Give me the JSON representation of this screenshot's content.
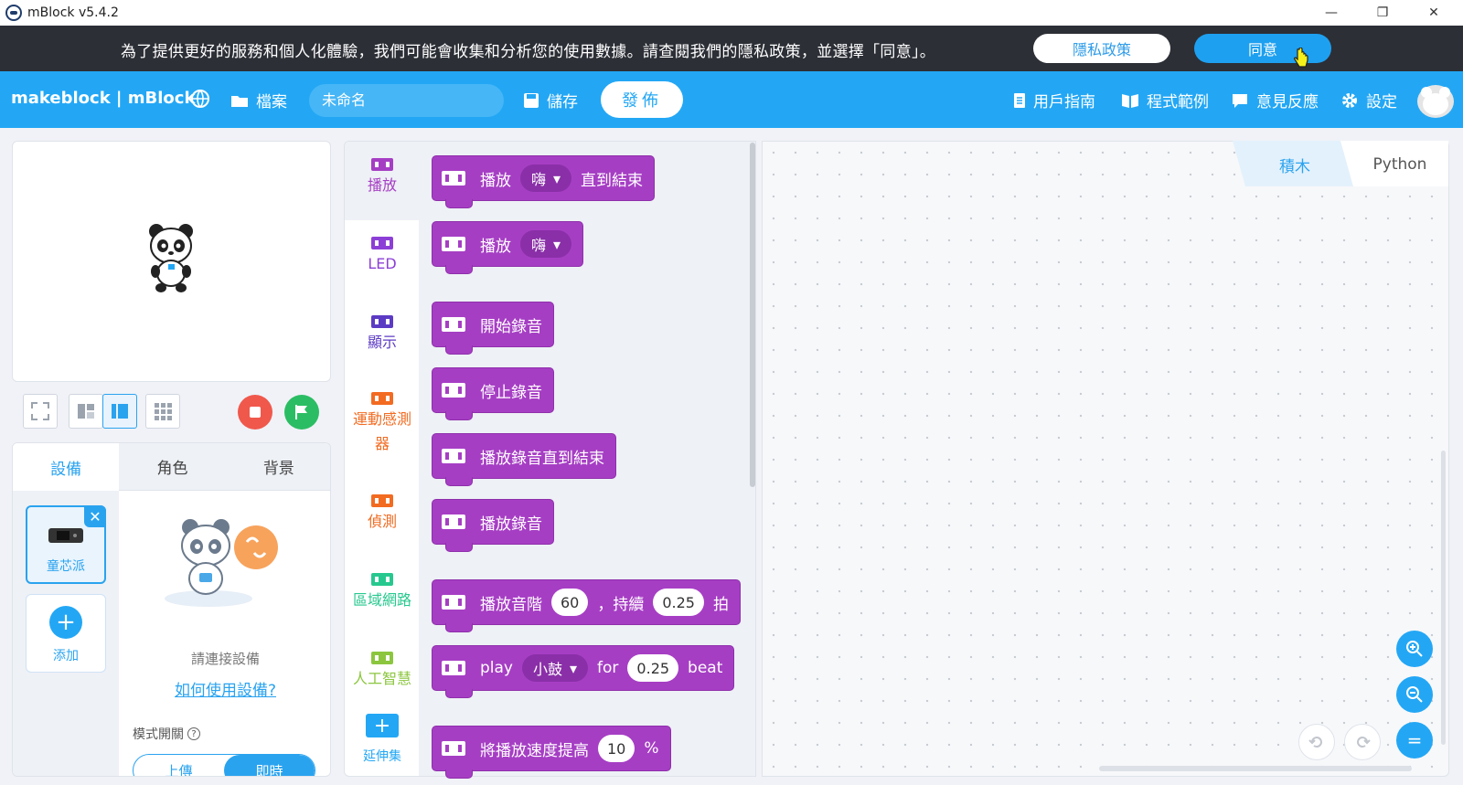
{
  "window": {
    "title": "mBlock v5.4.2",
    "controls": [
      "—",
      "❐",
      "✕"
    ]
  },
  "banner": {
    "message": "為了提供更好的服務和個人化體驗，我們可能會收集和分析您的使用數據。請查閱我們的隱私政策，並選擇「同意」。",
    "privacy_label": "隱私政策",
    "agree_label": "同意"
  },
  "toolbar": {
    "brand": "makeblock | mBlock",
    "file_label": "檔案",
    "project_name": "未命名",
    "save_label": "儲存",
    "publish_label": "發佈",
    "guide_label": "用戶指南",
    "examples_label": "程式範例",
    "feedback_label": "意見反應",
    "settings_label": "設定"
  },
  "device_panel": {
    "tabs": [
      "設備",
      "角色",
      "背景"
    ],
    "active_tab": "設備",
    "device_name": "童芯派",
    "add_label": "添加",
    "connect_prompt": "請連接設備",
    "howto_link": "如何使用設備?",
    "mode_label": "模式開關",
    "mode_options": [
      "上傳",
      "即時"
    ],
    "mode_selected": "即時"
  },
  "categories": [
    {
      "label": "播放",
      "color": "#a63ec4"
    },
    {
      "label": "LED",
      "color": "#8c3fd6"
    },
    {
      "label": "顯示",
      "color": "#5c3bc4"
    },
    {
      "label": "運動感測器",
      "color": "#f26b21"
    },
    {
      "label": "偵測",
      "color": "#f26b21"
    },
    {
      "label": "區域網路",
      "color": "#27c88f"
    },
    {
      "label": "人工智慧",
      "color": "#8cc63f"
    },
    {
      "label": "延伸集",
      "color": "#23a7f5"
    }
  ],
  "blocks": {
    "b1": {
      "pre": "播放",
      "dd": "嗨",
      "post": "直到結束"
    },
    "b2": {
      "pre": "播放",
      "dd": "嗨"
    },
    "b3": {
      "text": "開始錄音"
    },
    "b4": {
      "text": "停止錄音"
    },
    "b5": {
      "text": "播放錄音直到結束"
    },
    "b6": {
      "text": "播放錄音"
    },
    "b7": {
      "pre": "播放音階",
      "n1": "60",
      "mid": "，持續",
      "n2": "0.25",
      "post": "拍"
    },
    "b8": {
      "pre": "play",
      "dd": "小鼓",
      "mid": "for",
      "n1": "0.25",
      "post": "beat"
    },
    "b9": {
      "pre": "將播放速度提高",
      "n1": "10",
      "post": "%"
    }
  },
  "script_area": {
    "tab_blocks": "積木",
    "tab_python": "Python",
    "zoom_in": "⊕",
    "zoom_out": "⊖",
    "zoom_reset": "="
  }
}
